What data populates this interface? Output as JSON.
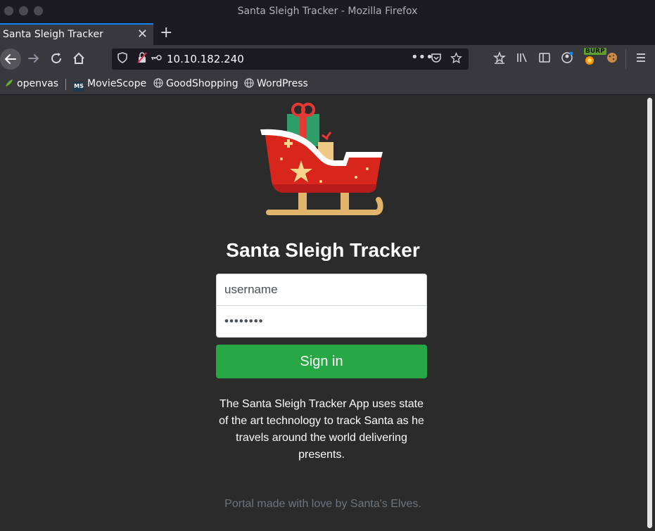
{
  "window": {
    "title": "Santa Sleigh Tracker - Mozilla Firefox"
  },
  "tabs": [
    {
      "label": "Santa Sleigh Tracker",
      "active": true
    }
  ],
  "toolbar": {
    "url": "10.10.182.240",
    "burp_badge": "BURP"
  },
  "bookmarks": [
    {
      "label": "openvas",
      "icon": "openvas-icon"
    },
    {
      "label": "MovieScope",
      "icon": "moviescope-icon"
    },
    {
      "label": "GoodShopping",
      "icon": "globe-icon"
    },
    {
      "label": "WordPress",
      "icon": "globe-icon"
    }
  ],
  "page": {
    "title": "Santa Sleigh Tracker",
    "username_value": "username",
    "password_value": "••••••••",
    "signin_label": "Sign in",
    "description": "The Santa Sleigh Tracker App uses state of the art technology to track Santa as he travels around the world delivering presents.",
    "footer": "Portal made with love by Santa's Elves."
  },
  "colors": {
    "page_bg": "#2b2b2b",
    "signin_bg": "#28a745",
    "footer_text": "#6c757d",
    "tab_accent": "#0a84ff"
  }
}
